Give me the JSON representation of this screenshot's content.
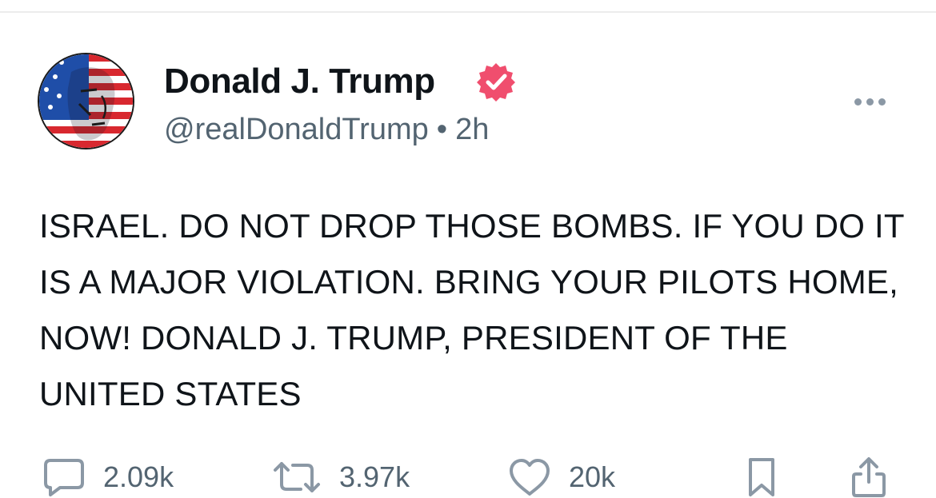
{
  "post": {
    "author": {
      "display_name": "Donald J. Trump",
      "handle": "@realDonaldTrump",
      "verified": true,
      "avatar_icon": "flag-portrait-avatar"
    },
    "separator": "•",
    "time_ago": "2h",
    "text": "ISRAEL. DO NOT DROP THOSE BOMBS. IF YOU DO IT IS A MAJOR VIOLATION. BRING YOUR PILOTS HOME, NOW! DONALD J. TRUMP, PRESIDENT OF THE UNITED STATES",
    "actions": {
      "replies": "2.09k",
      "reposts": "3.97k",
      "likes": "20k"
    }
  },
  "icons": {
    "verified": "verified-badge-icon",
    "more": "more-options-icon",
    "reply": "reply-icon",
    "repost": "repost-icon",
    "like": "heart-icon",
    "bookmark": "bookmark-icon",
    "share": "share-icon"
  },
  "colors": {
    "verified_badge": "#f04e6e",
    "text_primary": "#0f1419",
    "text_secondary": "#536471",
    "icon_gray": "#8b98a5"
  }
}
